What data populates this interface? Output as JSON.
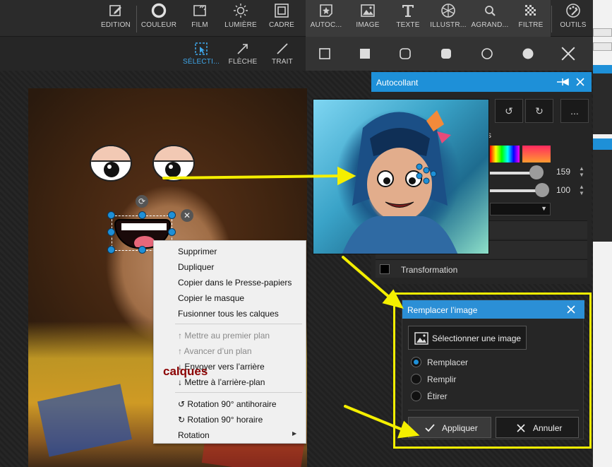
{
  "toolbar": {
    "tools": [
      {
        "label": "EDITION",
        "icon": "edit-icon"
      },
      {
        "label": "COULEUR",
        "icon": "color-icon"
      },
      {
        "label": "FILM",
        "icon": "film-icon"
      },
      {
        "label": "LUMIÈRE",
        "icon": "light-icon"
      },
      {
        "label": "CADRE",
        "icon": "frame-icon"
      },
      {
        "label": "AUTOC...",
        "icon": "sticker-icon"
      },
      {
        "label": "IMAGE",
        "icon": "image-icon"
      },
      {
        "label": "TEXTE",
        "icon": "text-icon"
      },
      {
        "label": "ILLUSTR...",
        "icon": "illustration-icon"
      },
      {
        "label": "AGRAND...",
        "icon": "zoom-icon"
      },
      {
        "label": "FILTRE",
        "icon": "filter-icon"
      },
      {
        "label": "OUTILS",
        "icon": "tools-icon"
      }
    ]
  },
  "subtoolbar": {
    "tools": [
      {
        "label": "SÉLECTI...",
        "icon": "select-icon"
      },
      {
        "label": "FLÈCHE",
        "icon": "arrow-icon"
      },
      {
        "label": "TRAIT",
        "icon": "line-icon"
      }
    ],
    "shapes": [
      "square-outline-icon",
      "square-filled-icon",
      "rounded-square-outline-icon",
      "rounded-square-filled-icon",
      "circle-outline-icon",
      "circle-filled-icon",
      "close-icon"
    ]
  },
  "context_menu": {
    "items": [
      {
        "label": "Supprimer",
        "enabled": true
      },
      {
        "label": "Dupliquer",
        "enabled": true
      },
      {
        "label": "Copier dans le Presse-papiers",
        "enabled": true
      },
      {
        "label": "Copier le masque",
        "enabled": true
      },
      {
        "label": "Fusionner tous les calques",
        "enabled": true
      },
      {
        "label": "Mettre au premier plan",
        "enabled": false
      },
      {
        "label": "Avancer d’un plan",
        "enabled": false
      },
      {
        "label": "Envoyer vers l’arrière",
        "enabled": true
      },
      {
        "label": "Mettre à l’arrière-plan",
        "enabled": true
      },
      {
        "label": "Rotation 90° antihoraire",
        "enabled": true
      },
      {
        "label": "Rotation 90° horaire",
        "enabled": true
      },
      {
        "label": "Rotation",
        "enabled": true
      }
    ]
  },
  "annotation": {
    "text": "calques"
  },
  "sticker_panel": {
    "title": "Autocollant",
    "more_label": "...",
    "slider1_value": "159",
    "slider2_value": "100",
    "row1": "es",
    "transformation_label": "Transformation",
    "row_s": "s"
  },
  "replace_dialog": {
    "title": "Remplacer l’image",
    "select_image_label": "Sélectionner une image",
    "options": [
      {
        "label": "Remplacer",
        "selected": true
      },
      {
        "label": "Remplir",
        "selected": false
      },
      {
        "label": "Étirer",
        "selected": false
      }
    ],
    "apply_label": "Appliquer",
    "cancel_label": "Annuler"
  },
  "colors": {
    "accent": "#1e90d8",
    "annotation_yellow": "#f4ef00",
    "annotation_text": "#8b0000"
  }
}
